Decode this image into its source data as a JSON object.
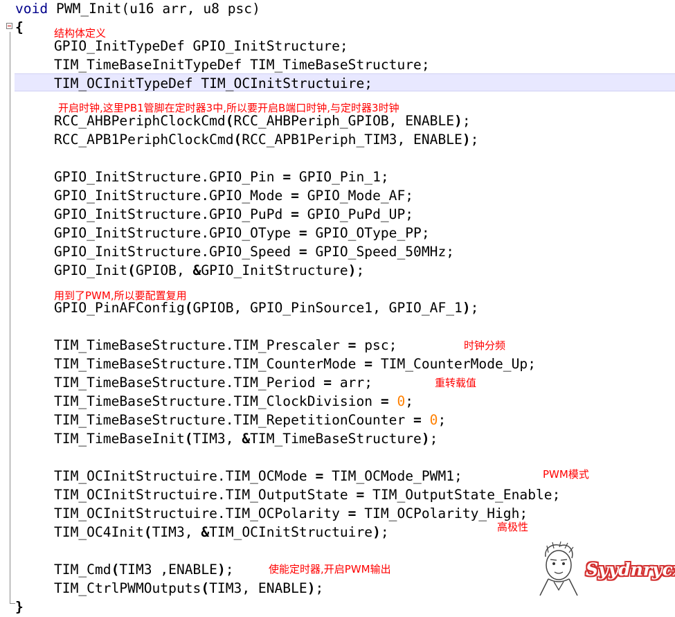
{
  "code": {
    "header": {
      "kw": "void",
      "rest": " PWM_Init(u16 arr, u8 psc)"
    },
    "open_brace": "{",
    "close_brace": "}",
    "l_gpio_decl": "GPIO_InitTypeDef GPIO_InitStructure;",
    "l_tim_decl": "TIM_TimeBaseInitTypeDef TIM_TimeBaseStructure;",
    "l_oc_decl": "TIM_OCInitTypeDef TIM_OCInitStructuire;",
    "l_rcc_ahb": {
      "a": "RCC_AHBPeriphClockCmd",
      "b": "RCC_AHBPeriph_GPIOB, ENABLE",
      "c": ";"
    },
    "l_rcc_apb": {
      "a": "RCC_APB1PeriphClockCmd",
      "b": "RCC_APB1Periph_TIM3, ENABLE",
      "c": ";"
    },
    "l_pin": {
      "a": "GPIO_InitStructure.GPIO_Pin ",
      "b": " GPIO_Pin_1;"
    },
    "l_mode": {
      "a": "GPIO_InitStructure.GPIO_Mode ",
      "b": " GPIO_Mode_AF;"
    },
    "l_pupd": {
      "a": "GPIO_InitStructure.GPIO_PuPd ",
      "b": " GPIO_PuPd_UP;"
    },
    "l_otype": {
      "a": "GPIO_InitStructure.GPIO_OType ",
      "b": " GPIO_OType_PP;"
    },
    "l_speed": {
      "a": "GPIO_InitStructure.GPIO_Speed ",
      "b": " GPIO_Speed_50MHz;"
    },
    "l_gpio_init": {
      "a": "GPIO_Init",
      "b": "GPIOB, ",
      "c": "GPIO_InitStructure",
      "d": ";"
    },
    "l_pinaf": {
      "a": "GPIO_PinAFConfig",
      "b": "GPIOB, GPIO_PinSource1, GPIO_AF_1",
      "c": ";"
    },
    "l_presc": {
      "a": "TIM_TimeBaseStructure.TIM_Prescaler ",
      "b": " psc;"
    },
    "l_cmode": {
      "a": "TIM_TimeBaseStructure.TIM_CounterMode ",
      "b": " TIM_CounterMode_Up;"
    },
    "l_period": {
      "a": "TIM_TimeBaseStructure.TIM_Period ",
      "b": " arr;"
    },
    "l_clkdiv": {
      "a": "TIM_TimeBaseStructure.TIM_ClockDivision ",
      "b": " ",
      "n": "0",
      "c": ";"
    },
    "l_rep": {
      "a": "TIM_TimeBaseStructure.TIM_RepetitionCounter ",
      "b": " ",
      "n": "0",
      "c": ";"
    },
    "l_tb_init": {
      "a": "TIM_TimeBaseInit",
      "b": "TIM3, ",
      "c": "TIM_TimeBaseStructure",
      "d": ";"
    },
    "l_ocmode": {
      "a": "TIM_OCInitStructuire.TIM_OCMode ",
      "b": " TIM_OCMode_PWM1;"
    },
    "l_outstate": {
      "a": "TIM_OCInitStructuire.TIM_OutputState ",
      "b": " TIM_OutputState_Enable;"
    },
    "l_ocpol": {
      "a": "TIM_OCInitStructuire.TIM_OCPolarity ",
      "b": " TIM_OCPolarity_High;"
    },
    "l_oc4init": {
      "a": "TIM_OC4Init",
      "b": "TIM3, ",
      "c": "TIM_OCInitStructuire",
      "d": ";"
    },
    "l_cmd": {
      "a": "TIM_Cmd",
      "b": "TIM3 ,ENABLE",
      "c": ";"
    },
    "l_ctrlpwm": {
      "a": "TIM_CtrlPWMOutputs",
      "b": "TIM3, ENABLE",
      "c": ";"
    }
  },
  "annotations": {
    "struct_def": "结构体定义",
    "clock_enable": "开启时钟,这里PB1管脚在定时器3中,所以要开启B端口时钟,与定时器3时钟",
    "pwm_af": "用到了PWM,所以要配置复用",
    "prescaler": "时钟分频",
    "reload": "重转载值",
    "pwm_mode": "PWM模式",
    "high_polarity": "高极性",
    "enable_timer": "使能定时器,开启PWM输出"
  },
  "watermark": {
    "text": "Syydnrycx"
  },
  "colors": {
    "keyword": "#00008b",
    "number": "#ff8000",
    "annotation": "#ff0000",
    "current_line": "#e8e8ff"
  }
}
